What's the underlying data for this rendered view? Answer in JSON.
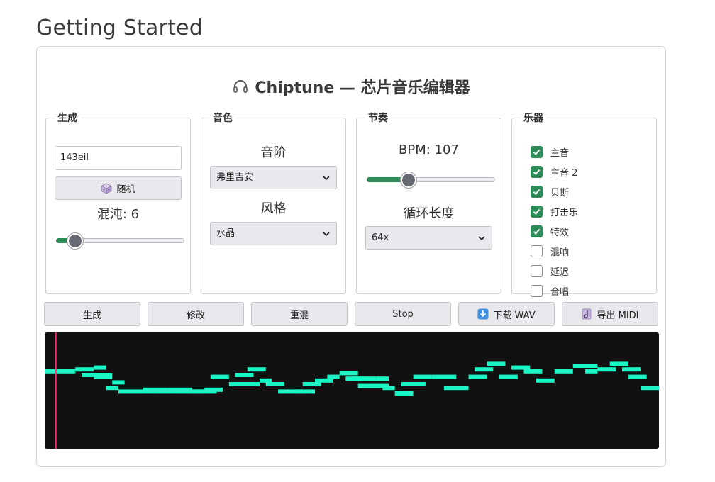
{
  "page": {
    "title": "Getting Started"
  },
  "app": {
    "title": "Chiptune — 芯片音乐编辑器",
    "icon": "headphones-icon"
  },
  "panels": {
    "generate": {
      "legend": "生成",
      "seed_value": "143eil",
      "random_button": "随机",
      "random_icon": "dice-icon",
      "chaos_label": "混沌: 6",
      "chaos_value": 6,
      "chaos_fraction": 0.1
    },
    "timbre": {
      "legend": "音色",
      "scale_label": "音阶",
      "scale_value": "弗里吉安",
      "style_label": "风格",
      "style_value": "水晶"
    },
    "rhythm": {
      "legend": "节奏",
      "bpm_label": "BPM: 107",
      "bpm_value": 107,
      "bpm_fraction": 0.3,
      "loop_label": "循环长度",
      "loop_value": "64x"
    },
    "instruments": {
      "legend": "乐器",
      "items": [
        {
          "label": "主音",
          "checked": true
        },
        {
          "label": "主音 2",
          "checked": true
        },
        {
          "label": "贝斯",
          "checked": true
        },
        {
          "label": "打击乐",
          "checked": true
        },
        {
          "label": "特效",
          "checked": true
        },
        {
          "label": "混响",
          "checked": false
        },
        {
          "label": "延迟",
          "checked": false
        },
        {
          "label": "合唱",
          "checked": false
        }
      ]
    }
  },
  "actions": {
    "generate": "生成",
    "modify": "修改",
    "remix": "重混",
    "stop": "Stop",
    "download_wav": "下载 WAV",
    "download_icon": "download-arrow-icon",
    "export_midi": "导出 MIDI",
    "midi_icon": "music-score-icon"
  },
  "visualizer": {
    "background": "#111111",
    "note_color": "#19f5c5",
    "playhead_color": "#e8356b",
    "playhead_fraction": 0.017,
    "notes": [
      [
        0.0,
        0.05,
        3
      ],
      [
        0.05,
        0.08,
        2
      ],
      [
        0.08,
        0.1,
        1
      ],
      [
        0.06,
        0.11,
        5
      ],
      [
        0.08,
        0.11,
        6
      ],
      [
        0.11,
        0.13,
        9
      ],
      [
        0.1,
        0.12,
        12
      ],
      [
        0.12,
        0.18,
        14
      ],
      [
        0.16,
        0.2,
        13
      ],
      [
        0.18,
        0.22,
        14
      ],
      [
        0.2,
        0.24,
        13
      ],
      [
        0.22,
        0.26,
        14
      ],
      [
        0.24,
        0.28,
        14
      ],
      [
        0.26,
        0.29,
        13
      ],
      [
        0.27,
        0.3,
        6
      ],
      [
        0.3,
        0.35,
        10
      ],
      [
        0.33,
        0.36,
        2
      ],
      [
        0.31,
        0.34,
        5
      ],
      [
        0.35,
        0.37,
        8
      ],
      [
        0.36,
        0.39,
        10
      ],
      [
        0.38,
        0.42,
        14
      ],
      [
        0.41,
        0.44,
        14
      ],
      [
        0.42,
        0.45,
        10
      ],
      [
        0.44,
        0.47,
        8
      ],
      [
        0.46,
        0.48,
        6
      ],
      [
        0.48,
        0.51,
        4
      ],
      [
        0.49,
        0.52,
        7
      ],
      [
        0.5,
        0.54,
        7
      ],
      [
        0.51,
        0.53,
        11
      ],
      [
        0.53,
        0.56,
        11
      ],
      [
        0.54,
        0.56,
        7
      ],
      [
        0.55,
        0.57,
        12
      ],
      [
        0.57,
        0.6,
        15
      ],
      [
        0.58,
        0.62,
        10
      ],
      [
        0.6,
        0.63,
        6
      ],
      [
        0.63,
        0.67,
        6
      ],
      [
        0.65,
        0.69,
        12
      ],
      [
        0.69,
        0.72,
        6
      ],
      [
        0.7,
        0.73,
        2
      ],
      [
        0.72,
        0.75,
        -1
      ],
      [
        0.74,
        0.77,
        6
      ],
      [
        0.76,
        0.79,
        1
      ],
      [
        0.78,
        0.81,
        3
      ],
      [
        0.8,
        0.83,
        8
      ],
      [
        0.83,
        0.86,
        3
      ],
      [
        0.86,
        0.9,
        0
      ],
      [
        0.9,
        0.93,
        2
      ],
      [
        0.92,
        0.95,
        -1
      ],
      [
        0.94,
        0.97,
        2
      ],
      [
        0.95,
        0.98,
        6
      ],
      [
        0.97,
        1.0,
        12
      ],
      [
        0.88,
        0.9,
        3
      ]
    ]
  }
}
